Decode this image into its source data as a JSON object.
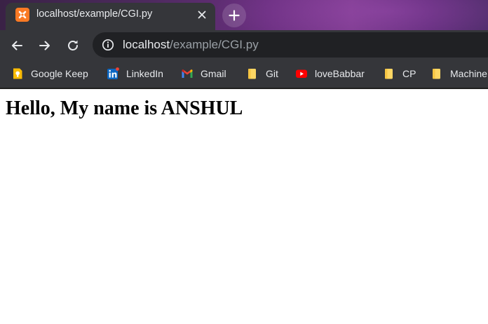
{
  "browser": {
    "tab": {
      "title": "localhost/example/CGI.py",
      "favicon": "xampp-icon",
      "close": "close-icon"
    },
    "new_tab_icon": "plus-icon",
    "toolbar": {
      "back_icon": "back-arrow-icon",
      "forward_icon": "forward-arrow-icon",
      "reload_icon": "reload-icon",
      "site_info_icon": "info-icon",
      "url_host": "localhost",
      "url_path": "/example/CGI.py"
    },
    "bookmarks": [
      {
        "label": "Google Keep",
        "icon": "google-keep-icon"
      },
      {
        "label": "LinkedIn",
        "icon": "linkedin-icon"
      },
      {
        "label": "Gmail",
        "icon": "gmail-icon"
      },
      {
        "label": "Git",
        "icon": "folder-icon"
      },
      {
        "label": "loveBabbar",
        "icon": "youtube-icon"
      },
      {
        "label": "CP",
        "icon": "folder-icon"
      },
      {
        "label": "Machine",
        "icon": "folder-icon"
      }
    ]
  },
  "page": {
    "heading": "Hello, My name is ANSHUL"
  },
  "colors": {
    "frame": "#35363a",
    "omnibox": "#202124",
    "text_primary": "#e8eaed",
    "text_secondary": "#9aa0a6",
    "folder": "#fdd663"
  }
}
